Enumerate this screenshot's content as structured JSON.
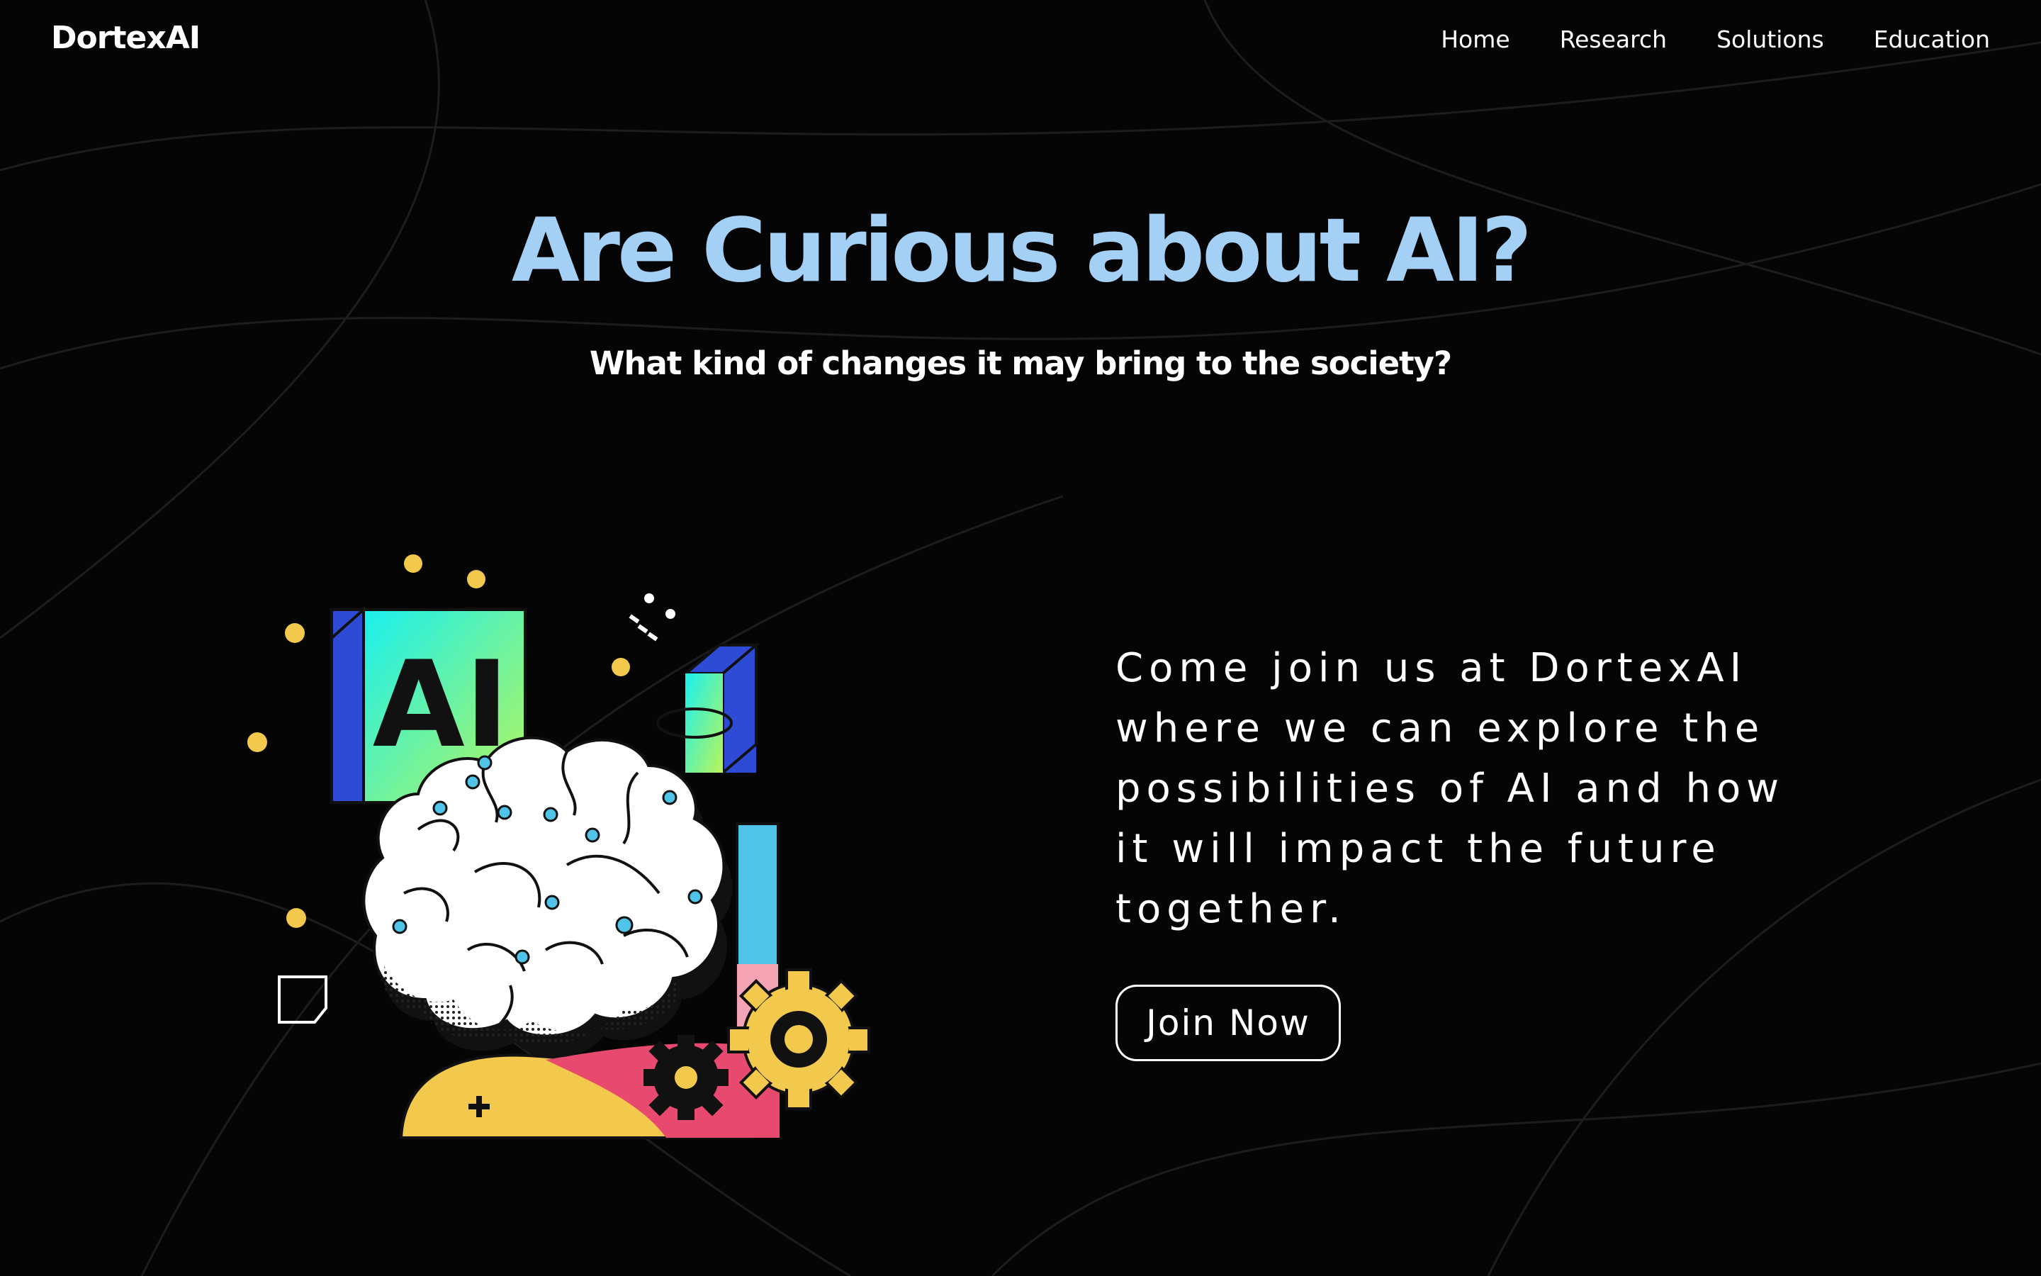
{
  "brand": {
    "name": "DortexAI"
  },
  "nav": {
    "items": [
      {
        "label": "Home"
      },
      {
        "label": "Research"
      },
      {
        "label": "Solutions"
      },
      {
        "label": "Education"
      }
    ]
  },
  "hero": {
    "title": "Are Curious about AI?",
    "subtitle": "What kind of changes it may bring to the society?"
  },
  "illustration": {
    "cube_label": "AI",
    "icons": [
      "brain-icon",
      "atom-icon",
      "gear-icon",
      "note-icon",
      "plus-icon"
    ]
  },
  "cta": {
    "text": "Come join us at DortexAI where we can explore the possibilities of AI and how it will impact the future together.",
    "button_label": "Join Now"
  },
  "colors": {
    "background": "#050505",
    "title": "#a5d0f5",
    "text": "#ffffff",
    "accent_yellow": "#f2c94c",
    "accent_cyan": "#4fc3e8",
    "accent_blue": "#2e4bd6",
    "accent_pink": "#e85a7a"
  }
}
